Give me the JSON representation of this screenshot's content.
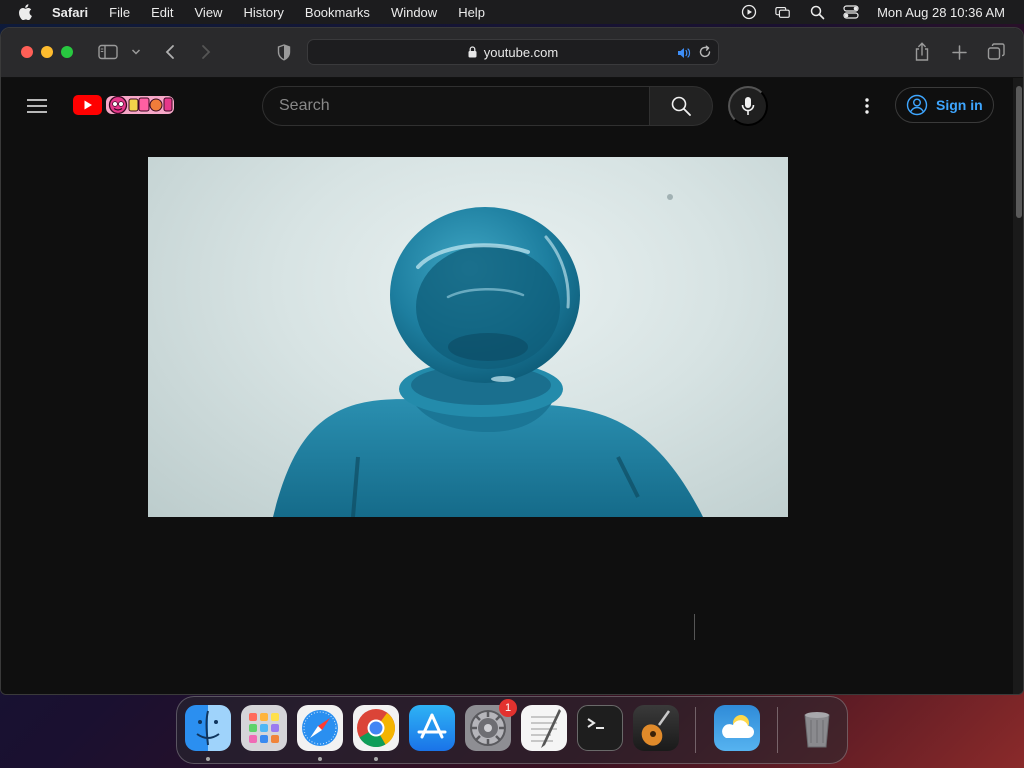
{
  "menubar": {
    "app_name": "Safari",
    "menus": [
      "File",
      "Edit",
      "View",
      "History",
      "Bookmarks",
      "Window",
      "Help"
    ],
    "clock": "Mon Aug 28  10:36 AM",
    "status_icons": [
      "play-circle-icon",
      "screen-mirroring-icon",
      "spotlight-search-icon",
      "control-center-icon"
    ]
  },
  "safari": {
    "url": "youtube.com",
    "icons": [
      "sidebar-icon",
      "chevron-down-icon",
      "back-icon",
      "forward-icon",
      "privacy-shield-icon",
      "lock-icon",
      "audio-playing-icon",
      "reload-icon",
      "share-icon",
      "new-tab-icon",
      "tab-overview-icon"
    ]
  },
  "youtube": {
    "search_placeholder": "Search",
    "signin_label": "Sign in",
    "video": {
      "description_icons": [
        "astronaut-helmet"
      ]
    }
  },
  "dock": {
    "apps": [
      {
        "name": "Finder",
        "icon": "finder-icon",
        "running": true
      },
      {
        "name": "Launchpad",
        "icon": "launchpad-icon",
        "running": false
      },
      {
        "name": "Safari",
        "icon": "safari-icon",
        "running": true
      },
      {
        "name": "Google Chrome",
        "icon": "chrome-icon",
        "running": true
      },
      {
        "name": "App Store",
        "icon": "app-store-icon",
        "running": false
      },
      {
        "name": "System Settings",
        "icon": "system-settings-icon",
        "running": false,
        "badge": "1"
      },
      {
        "name": "TextEdit",
        "icon": "textedit-icon",
        "running": false
      },
      {
        "name": "Terminal",
        "icon": "terminal-icon",
        "running": false
      },
      {
        "name": "GarageBand",
        "icon": "garageband-icon",
        "running": false
      },
      {
        "name": "Weather",
        "icon": "weather-icon",
        "running": false
      },
      {
        "name": "Trash",
        "icon": "trash-icon",
        "running": false
      }
    ]
  },
  "colors": {
    "youtube_red": "#ff0000",
    "signin_blue": "#3ea6ff",
    "page_bg": "#0f0f0f"
  }
}
